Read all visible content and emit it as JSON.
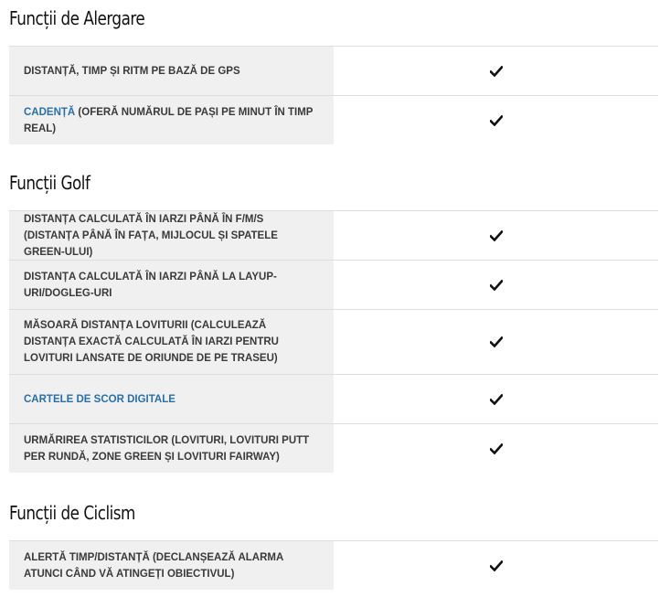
{
  "sections": [
    {
      "title": "Funcții de Alergare",
      "rows": [
        {
          "link": "",
          "text": "Distanță, timp și ritm pe bază de GPS",
          "checked": true
        },
        {
          "link": "Cadență",
          "text": " (oferă numărul de pași pe minut în timp real)",
          "checked": true
        }
      ]
    },
    {
      "title": "Funcții Golf",
      "rows": [
        {
          "link": "",
          "text": "Distanța calculată în iarzi până în F/M/S (distanța până în fața, mijlocul și spatele green-ului)",
          "checked": true
        },
        {
          "link": "",
          "text": "Distanța calculată în iarzi până la layup-uri/dogleg-uri",
          "checked": true
        },
        {
          "link": "",
          "text": "Măsoară distanța loviturii (calculează distanța exactă calculată în iarzi pentru lovituri lansate de oriunde de pe traseu)",
          "checked": true
        },
        {
          "link": "Cartele de scor digitale",
          "text": "",
          "checked": true
        },
        {
          "link": "",
          "text": "Urmărirea statisticilor (lovituri, lovituri putt per rundă, zone green și lovituri fairway)",
          "checked": true
        }
      ]
    },
    {
      "title": "Funcții de Ciclism",
      "rows": [
        {
          "link": "",
          "text": "Alertă timp/distanță (declanșează alarma atunci când vă atingeți obiectivul)",
          "checked": true
        }
      ]
    }
  ]
}
